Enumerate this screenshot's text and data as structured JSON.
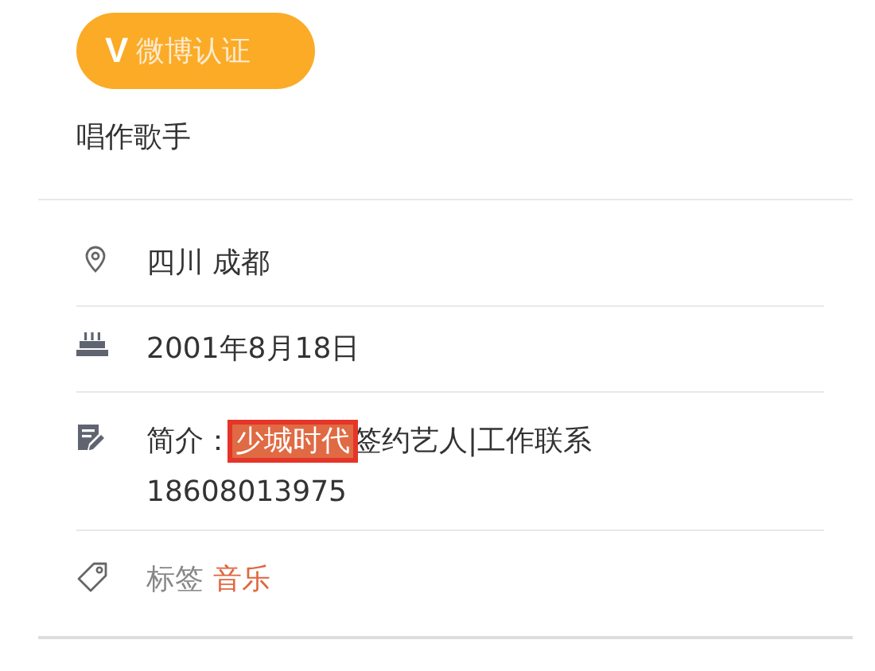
{
  "badge": {
    "icon": "V",
    "label": "微博认证"
  },
  "description": "唱作歌手",
  "details": [
    {
      "kind": "location",
      "text": "四川 成都"
    },
    {
      "kind": "birthday",
      "text": "2001年8月18日"
    },
    {
      "kind": "bio",
      "label": "简介：",
      "highlight": "少城时代",
      "text": "签约艺人|工作联系18608013975"
    },
    {
      "kind": "tags",
      "label": "标签",
      "tags": [
        "音乐"
      ]
    }
  ]
}
